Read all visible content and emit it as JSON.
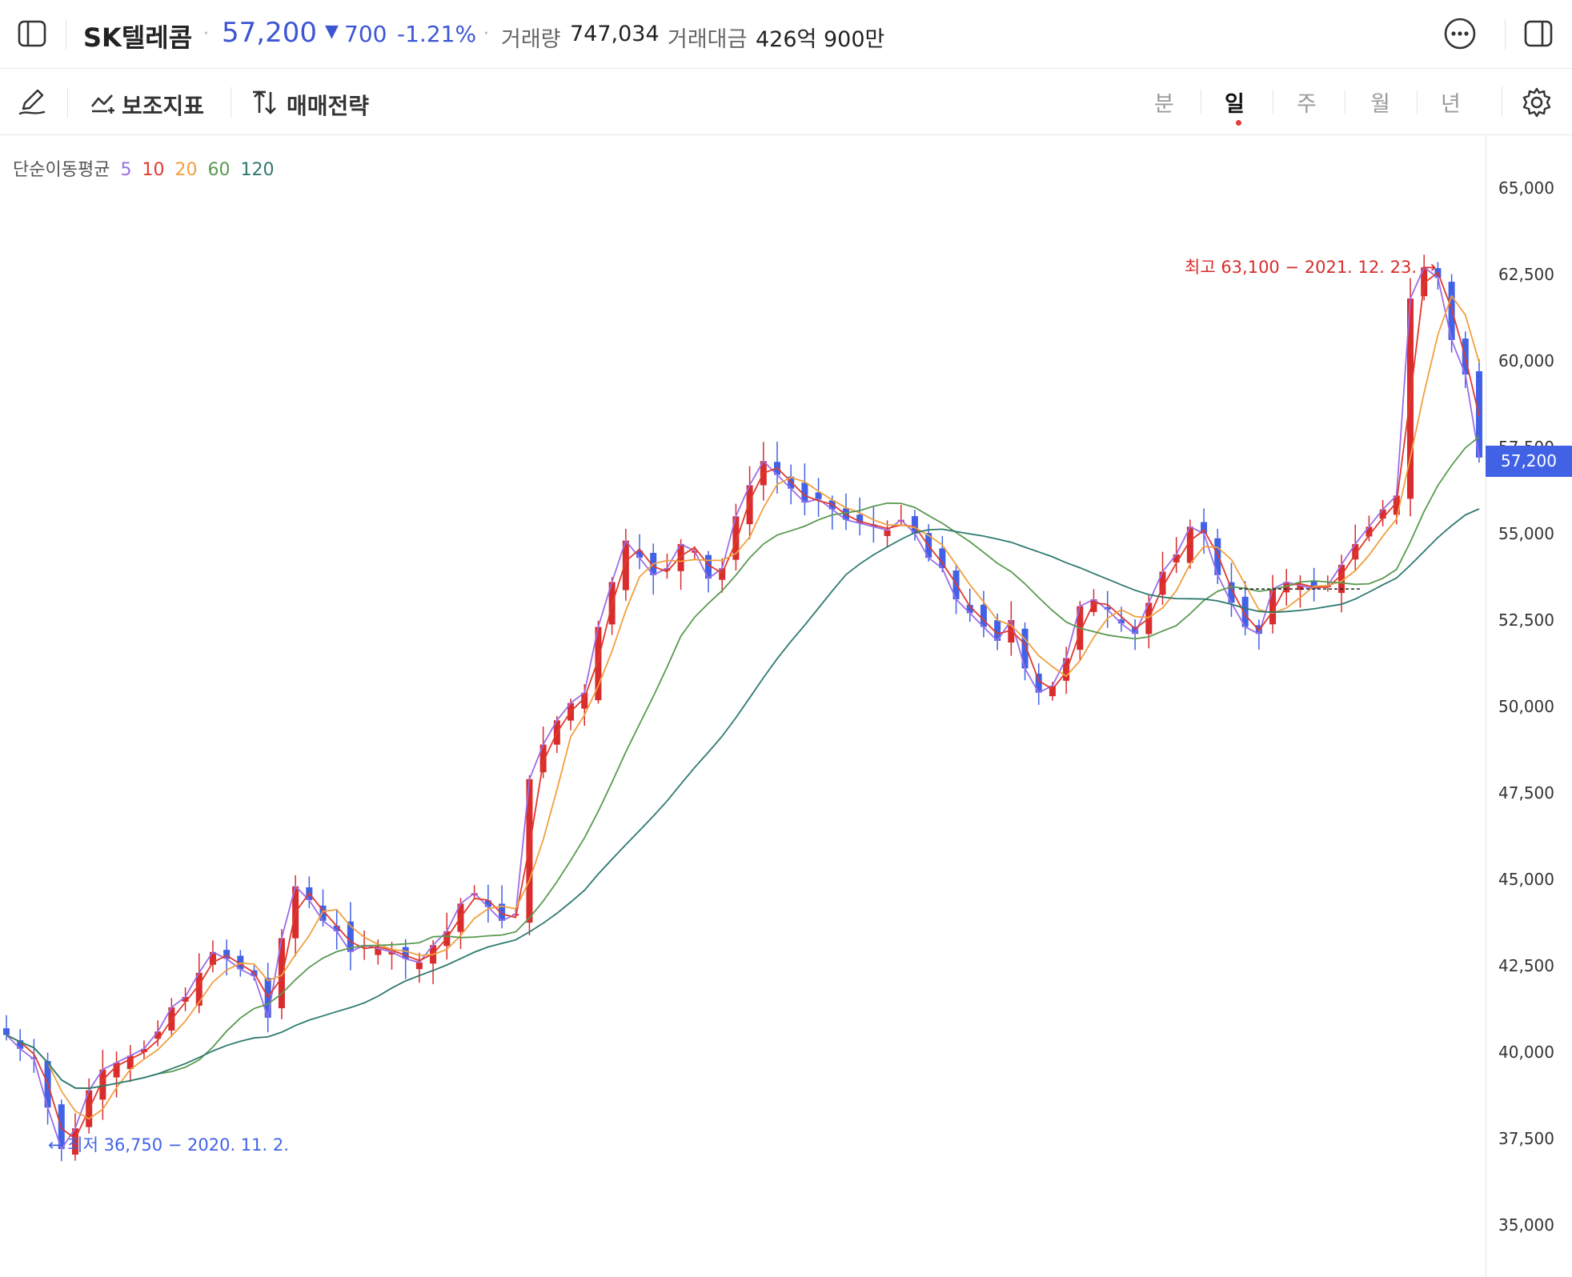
{
  "header": {
    "stock_name": "SK텔레콤",
    "price": "57,200",
    "change_arrow": "▼",
    "change_amount": "700",
    "change_rate": "-1.21%",
    "volume_label": "거래량",
    "volume_value": "747,034",
    "amount_label": "거래대금",
    "amount_value": "426억 900만",
    "icons": [
      "sidebar-left-icon",
      "more-icon",
      "sidebar-right-icon"
    ]
  },
  "toolbar": {
    "indicator_label": "보조지표",
    "strategy_label": "매매전략",
    "periods": [
      "분",
      "일",
      "주",
      "월",
      "년"
    ],
    "active_period": "일",
    "icons": [
      "pencil-icon",
      "indicator-icon",
      "strategy-icon",
      "settings-icon"
    ]
  },
  "legend": {
    "title": "단순이동평균",
    "ma": [
      {
        "label": "5",
        "color": "#9b6ee8"
      },
      {
        "label": "10",
        "color": "#e03a2f"
      },
      {
        "label": "20",
        "color": "#f0a040"
      },
      {
        "label": "60",
        "color": "#5a9a52"
      },
      {
        "label": "120",
        "color": "#2f7a70"
      }
    ]
  },
  "axis": {
    "ticks": [
      "65,000",
      "62,500",
      "60,000",
      "57,500",
      "55,000",
      "52,500",
      "50,000",
      "47,500",
      "45,000",
      "42,500",
      "40,000",
      "37,500",
      "35,000"
    ],
    "current_price": "57,200"
  },
  "annotations": {
    "high": "최고 63,100 − 2021. 12. 23. →",
    "low": "← 최저 36,750 − 2020. 11. 2."
  },
  "colors": {
    "up": "#d92c2c",
    "down": "#4262e6",
    "accent": "#3c55d3"
  },
  "chart_data": {
    "type": "candlestick",
    "ylim": [
      33500,
      66500
    ],
    "y_ticks": [
      35000,
      37500,
      40000,
      42500,
      45000,
      47500,
      50000,
      52500,
      55000,
      57500,
      60000,
      62500,
      65000
    ],
    "period": "daily",
    "high": 63100,
    "low": 36750,
    "last": 57200,
    "close_series": [
      40500,
      40100,
      39800,
      38400,
      37200,
      37800,
      38900,
      39500,
      39700,
      39900,
      40100,
      40600,
      41300,
      41600,
      42300,
      42900,
      42700,
      42400,
      42200,
      41000,
      43300,
      44800,
      44400,
      43800,
      43500,
      42900,
      43100,
      43000,
      42900,
      42700,
      42600,
      43100,
      43500,
      44300,
      44600,
      44200,
      43800,
      44000,
      47900,
      48900,
      49600,
      50100,
      50400,
      52300,
      53600,
      54800,
      54300,
      53800,
      54000,
      54700,
      54500,
      53700,
      54000,
      55500,
      56400,
      57100,
      56700,
      56300,
      55900,
      56000,
      55700,
      55400,
      55300,
      55200,
      55100,
      55400,
      55000,
      54300,
      54000,
      53100,
      52700,
      52300,
      51900,
      52500,
      51100,
      50400,
      50600,
      51400,
      52900,
      53100,
      52800,
      52400,
      52100,
      53000,
      53900,
      54400,
      55200,
      55000,
      53800,
      53000,
      52300,
      52100,
      53400,
      53600,
      53500,
      53400,
      53500,
      54100,
      54700,
      55200,
      55700,
      56100,
      61800,
      62700,
      62400,
      60600,
      59600,
      57200
    ]
  }
}
